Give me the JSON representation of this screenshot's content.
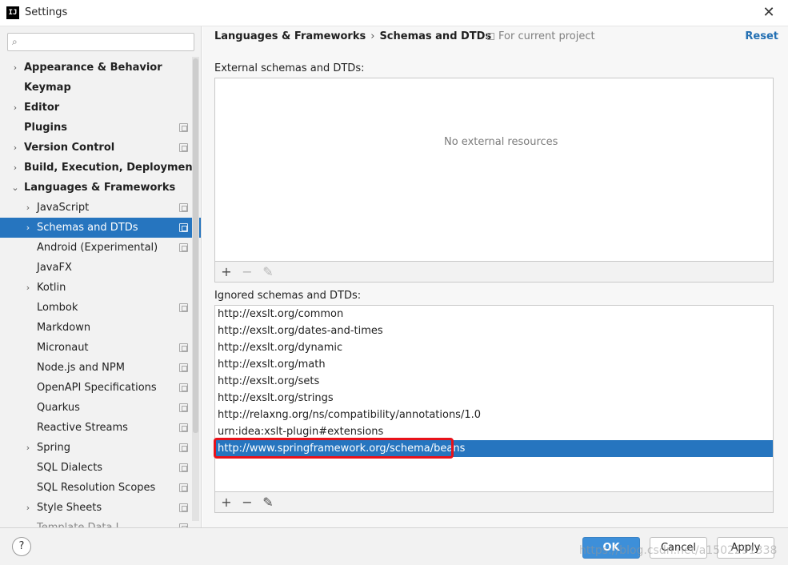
{
  "window": {
    "title": "Settings",
    "app_icon": "IJ"
  },
  "search": {
    "placeholder": "",
    "value": "",
    "icon": "search-icon"
  },
  "tree": [
    {
      "label": "Appearance & Behavior",
      "level": 0,
      "chevron": "›",
      "proj": false
    },
    {
      "label": "Keymap",
      "level": 0,
      "chevron": "",
      "proj": false
    },
    {
      "label": "Editor",
      "level": 0,
      "chevron": "›",
      "proj": false
    },
    {
      "label": "Plugins",
      "level": 0,
      "chevron": "",
      "proj": true
    },
    {
      "label": "Version Control",
      "level": 0,
      "chevron": "›",
      "proj": true
    },
    {
      "label": "Build, Execution, Deployment",
      "level": 0,
      "chevron": "›",
      "proj": false
    },
    {
      "label": "Languages & Frameworks",
      "level": 0,
      "chevron": "⌄",
      "proj": false
    },
    {
      "label": "JavaScript",
      "level": 1,
      "chevron": "›",
      "proj": true
    },
    {
      "label": "Schemas and DTDs",
      "level": 1,
      "chevron": "›",
      "proj": true,
      "selected": true
    },
    {
      "label": "Android (Experimental)",
      "level": 1,
      "chevron": "",
      "proj": true
    },
    {
      "label": "JavaFX",
      "level": 1,
      "chevron": "",
      "proj": false
    },
    {
      "label": "Kotlin",
      "level": 1,
      "chevron": "›",
      "proj": false
    },
    {
      "label": "Lombok",
      "level": 1,
      "chevron": "",
      "proj": true
    },
    {
      "label": "Markdown",
      "level": 1,
      "chevron": "",
      "proj": false
    },
    {
      "label": "Micronaut",
      "level": 1,
      "chevron": "",
      "proj": true
    },
    {
      "label": "Node.js and NPM",
      "level": 1,
      "chevron": "",
      "proj": true
    },
    {
      "label": "OpenAPI Specifications",
      "level": 1,
      "chevron": "",
      "proj": true
    },
    {
      "label": "Quarkus",
      "level": 1,
      "chevron": "",
      "proj": true
    },
    {
      "label": "Reactive Streams",
      "level": 1,
      "chevron": "",
      "proj": true
    },
    {
      "label": "Spring",
      "level": 1,
      "chevron": "›",
      "proj": true
    },
    {
      "label": "SQL Dialects",
      "level": 1,
      "chevron": "",
      "proj": true
    },
    {
      "label": "SQL Resolution Scopes",
      "level": 1,
      "chevron": "",
      "proj": true
    },
    {
      "label": "Style Sheets",
      "level": 1,
      "chevron": "›",
      "proj": true
    },
    {
      "label": "Template Data L...",
      "level": 1,
      "chevron": "",
      "proj": true,
      "cut": true
    }
  ],
  "header": {
    "breadcrumb": [
      "Languages & Frameworks",
      "Schemas and DTDs"
    ],
    "separator": "›",
    "scope": "For current project",
    "reset": "Reset"
  },
  "external": {
    "label": "External schemas and DTDs:",
    "empty_text": "No external resources"
  },
  "ignored": {
    "label": "Ignored schemas and DTDs:",
    "items": [
      "http://exslt.org/common",
      "http://exslt.org/dates-and-times",
      "http://exslt.org/dynamic",
      "http://exslt.org/math",
      "http://exslt.org/sets",
      "http://exslt.org/strings",
      "http://relaxng.org/ns/compatibility/annotations/1.0",
      "urn:idea:xslt-plugin#extensions",
      "http://www.springframework.org/schema/beans"
    ],
    "selected_index": 8
  },
  "toolbar": {
    "add": "+",
    "remove": "−",
    "edit": "✎"
  },
  "footer": {
    "help": "?",
    "ok": "OK",
    "cancel": "Cancel",
    "apply": "Apply",
    "watermark": "https://blog.csdn.net/a1502291338"
  },
  "colors": {
    "selection": "#2675bf",
    "primary_button": "#3d8fd9",
    "link": "#2470b3",
    "highlight": "#e8121a"
  }
}
